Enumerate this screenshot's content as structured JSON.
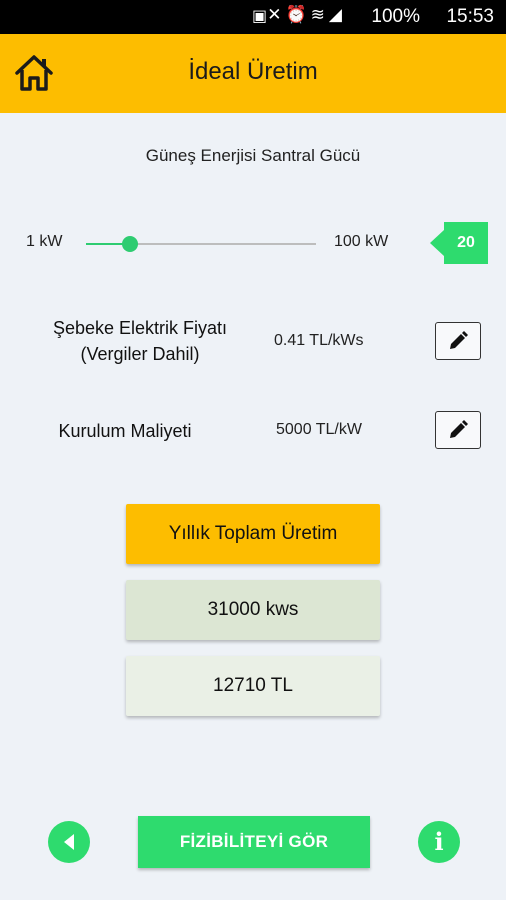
{
  "status_bar": {
    "time": "15:53",
    "battery": "100%",
    "icons": [
      "notification-icon",
      "mute-icon",
      "alarm-icon",
      "wifi-icon",
      "signal-icon",
      "battery-icon"
    ]
  },
  "header": {
    "title": "İdeal Üretim",
    "home_icon": "home-icon",
    "background": "#fdbd00"
  },
  "power": {
    "title": "Güneş Enerjisi Santral Gücü",
    "min_label": "1 kW",
    "max_label": "100 kW",
    "value": "20",
    "min": 1,
    "max": 100,
    "level": 20
  },
  "price": {
    "label_line1": "Şebeke Elektrik Fiyatı",
    "label_line2": "(Vergiler Dahil)",
    "value": "0.41 TL/kWs",
    "edit_icon": "pencil-icon"
  },
  "cost": {
    "label": "Kurulum Maliyeti",
    "value": "5000 TL/kW",
    "edit_icon": "pencil-icon"
  },
  "results": {
    "header": "Yıllık Toplam Üretim",
    "production": "31000 kws",
    "amount": "12710 TL"
  },
  "footer": {
    "back_icon": "back-arrow-icon",
    "action_label": "FİZİBİLİTEYİ GÖR",
    "info_icon": "info-icon",
    "info_glyph": "i",
    "accent": "#2edb6e"
  }
}
